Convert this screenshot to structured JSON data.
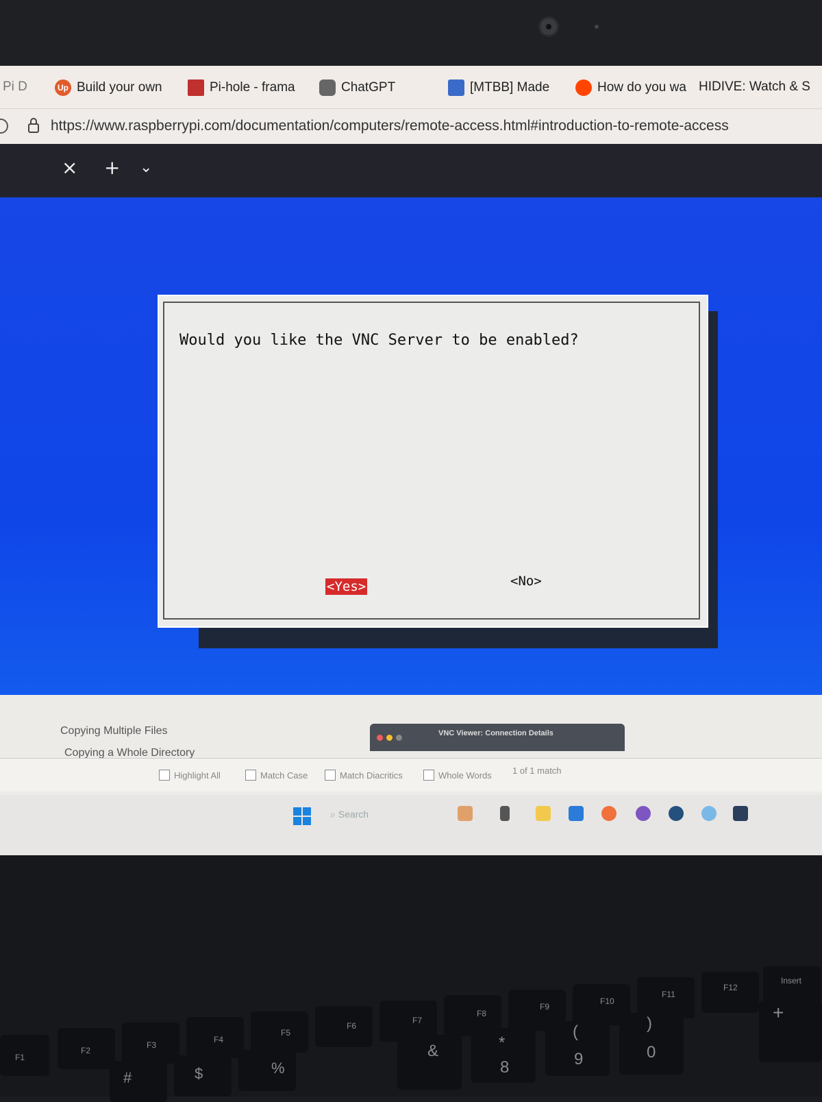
{
  "bookmarks": [
    {
      "label": "Pi D",
      "fav": ""
    },
    {
      "label": "Build your own",
      "fav": "Up"
    },
    {
      "label": "Pi-hole - frama",
      "fav": ""
    },
    {
      "label": "ChatGPT",
      "fav": ""
    },
    {
      "label": "[MTBB] Made",
      "fav": ""
    },
    {
      "label": "How do you wa",
      "fav": ""
    },
    {
      "label": "HIDIVE: Watch & S",
      "fav": ""
    }
  ],
  "address_bar": {
    "url": "https://www.raspberrypi.com/documentation/computers/remote-access.html#introduction-to-remote-access"
  },
  "terminal_tabs": {
    "close": "×",
    "new": "+",
    "dropdown": "⌄"
  },
  "dialog": {
    "message": "Would you like the VNC Server to be enabled?",
    "yes_label": "<Yes>",
    "no_label": "<No>"
  },
  "docs": {
    "links": [
      "Copying Multiple Files",
      "Copying a Whole Directory"
    ]
  },
  "vnc_window": {
    "title": "VNC Viewer: Connection Details"
  },
  "find_bar": {
    "highlight_all": "Highlight All",
    "match_case": "Match Case",
    "match_diacritics": "Match Diacritics",
    "whole_words": "Whole Words",
    "result": "1 of 1 match"
  },
  "taskbar": {
    "search_placeholder": "Search"
  },
  "keyboard": {
    "fkeys": [
      "F1",
      "F2",
      "F3",
      "F4",
      "F5",
      "F6",
      "F7",
      "F8",
      "F9",
      "F10",
      "F11",
      "F12",
      "Insert"
    ],
    "symbols": [
      "#",
      "$",
      "%",
      "&",
      "*",
      "(",
      ")",
      "+"
    ],
    "digits": [
      "8",
      "9",
      "0"
    ]
  },
  "colors": {
    "desktop_blue": "#0f46e8",
    "dialog_bg": "#ececea",
    "yes_button": "#d62b2b"
  }
}
